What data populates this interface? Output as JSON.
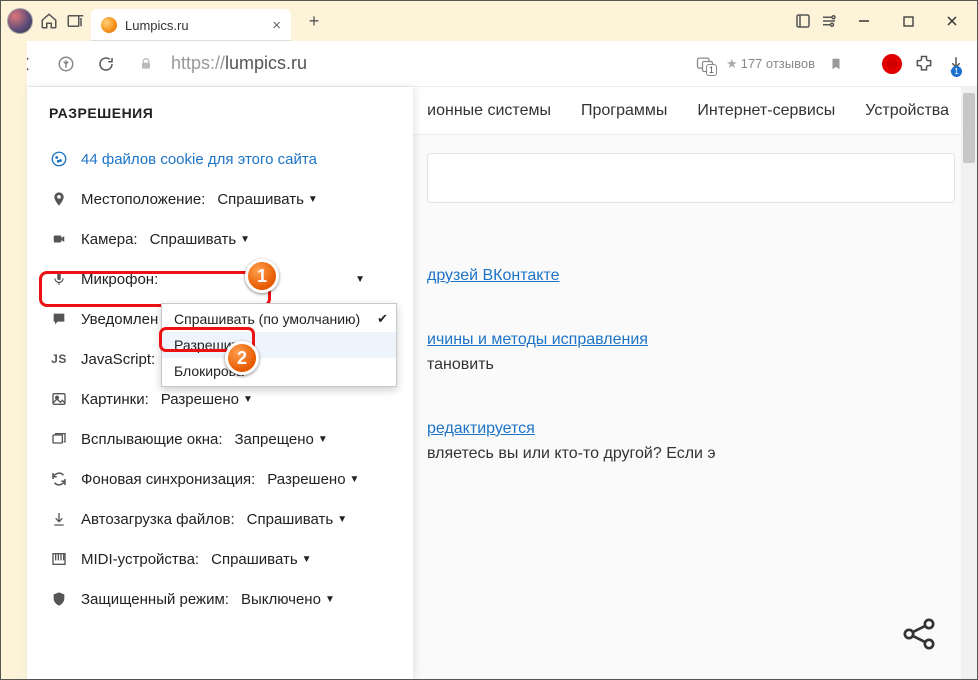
{
  "tab": {
    "title": "Lumpics.ru"
  },
  "addr": {
    "scheme": "https://",
    "host": "lumpics.ru",
    "reviews": "177 отзывов"
  },
  "nav": {
    "items": [
      "ионные системы",
      "Программы",
      "Интернет-сервисы",
      "Устройства"
    ]
  },
  "article": {
    "link1": "друзей ВКонтакте",
    "link2": "ичины и методы исправления",
    "text2": "тановить",
    "link3": "редактируется",
    "text3": "вляетесь вы или кто-то другой? Если э"
  },
  "perm": {
    "title": "РАЗРЕШЕНИЯ",
    "cookies": "44 файлов cookie для этого сайта",
    "rows": {
      "location": {
        "label": "Местоположение:",
        "value": "Спрашивать"
      },
      "camera": {
        "label": "Камера:",
        "value": "Спрашивать"
      },
      "mic": {
        "label": "Микрофон:",
        "value": ""
      },
      "notif": {
        "label": "Уведомлен",
        "value": ""
      },
      "js": {
        "label": "JavaScript:",
        "value": ""
      },
      "images": {
        "label": "Картинки:",
        "value": "Разрешено"
      },
      "popups": {
        "label": "Всплывающие окна:",
        "value": "Запрещено"
      },
      "bgsync": {
        "label": "Фоновая синхронизация:",
        "value": "Разрешено"
      },
      "autodl": {
        "label": "Автозагрузка файлов:",
        "value": "Спрашивать"
      },
      "midi": {
        "label": "MIDI-устройства:",
        "value": "Спрашивать"
      },
      "protected": {
        "label": "Защищенный режим:",
        "value": "Выключено"
      }
    }
  },
  "dd": {
    "opt1": "Спрашивать (по умолчанию)",
    "opt2": "Разрешить",
    "opt3": "Блокирова"
  },
  "badges": {
    "one": "1",
    "two": "2"
  }
}
